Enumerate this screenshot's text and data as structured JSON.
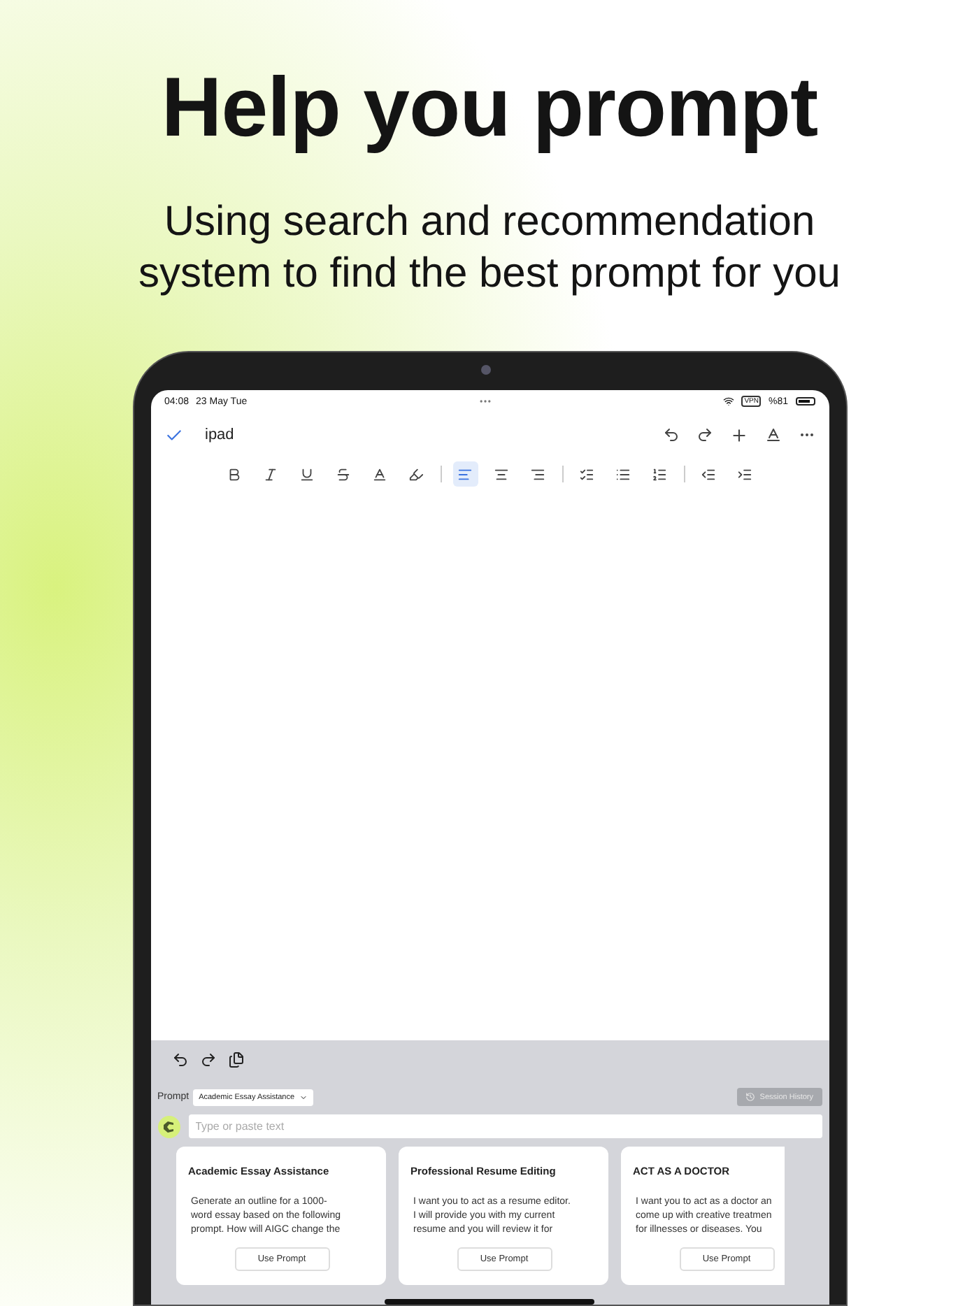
{
  "headline": "Help you prompt",
  "subtitle_lines": [
    "Using search and recommendation",
    "system to find the best prompt for you"
  ],
  "status_bar": {
    "time": "04:08",
    "date": "23 May Tue",
    "vpn": "VPN",
    "battery": "%81"
  },
  "document": {
    "title": "ipad"
  },
  "format_toolbar": [
    {
      "kind": "bold",
      "selected": false
    },
    {
      "kind": "italic",
      "selected": false
    },
    {
      "kind": "underline",
      "selected": false
    },
    {
      "kind": "strike",
      "selected": false
    },
    {
      "kind": "color",
      "selected": false
    },
    {
      "kind": "highlight",
      "selected": false
    },
    {
      "kind": "separator"
    },
    {
      "kind": "alignleft",
      "selected": true
    },
    {
      "kind": "aligncenter",
      "selected": false
    },
    {
      "kind": "alignright",
      "selected": false
    },
    {
      "kind": "separator"
    },
    {
      "kind": "checklist",
      "selected": false
    },
    {
      "kind": "bullets",
      "selected": false
    },
    {
      "kind": "numbers",
      "selected": false
    },
    {
      "kind": "separator"
    },
    {
      "kind": "outdent",
      "selected": false
    },
    {
      "kind": "indent",
      "selected": false
    }
  ],
  "prompt_panel": {
    "label": "Prompt",
    "selected_prompt": "Academic Essay Assistance",
    "history_button": "Session History",
    "history_disabled": true,
    "input_placeholder": "Type or paste text"
  },
  "cards": [
    {
      "title": "Academic Essay Assistance",
      "lines": [
        "Generate an outline for a 1000-",
        "word essay based on the following",
        "prompt. How will AIGC change the"
      ],
      "button": "Use Prompt"
    },
    {
      "title": "Professional Resume Editing",
      "lines": [
        "I want you to act as a resume editor.",
        "I will provide you with my current",
        "resume and you will review it for"
      ],
      "button": "Use Prompt"
    },
    {
      "title": "ACT AS A DOCTOR",
      "lines": [
        "I want you to act as a doctor an",
        "come up with creative treatmen",
        "for illnesses or diseases. You"
      ],
      "button": "Use Prompt"
    }
  ]
}
